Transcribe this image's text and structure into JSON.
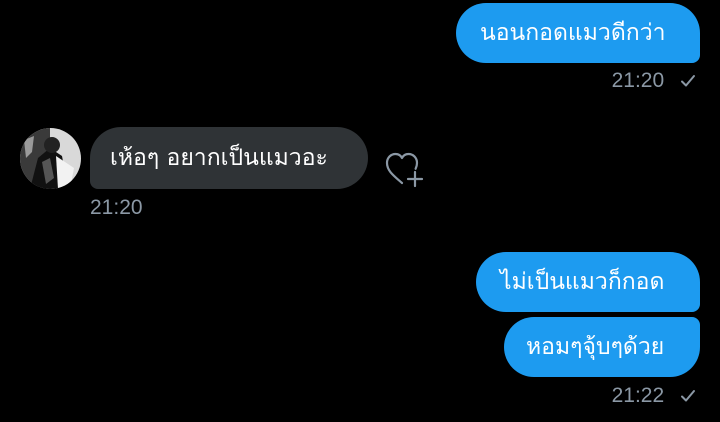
{
  "colors": {
    "background": "#000000",
    "outgoing_bubble": "#1d9bf0",
    "incoming_bubble": "#2f3336",
    "timestamp": "#8b98a5"
  },
  "messages": [
    {
      "direction": "outgoing",
      "text": "นอนกอดแมวดีกว่า"
    },
    {
      "direction": "incoming",
      "text": "เห้อๆ อยากเป็นแมวอะ"
    },
    {
      "direction": "outgoing",
      "text": "ไม่เป็นแมวก็กอด"
    },
    {
      "direction": "outgoing",
      "text": "หอมๆจุ้บๆด้วย"
    }
  ],
  "timestamps": [
    {
      "time": "21:20",
      "status_icon": "read-check-icon"
    },
    {
      "time": "21:20"
    },
    {
      "time": "21:22",
      "status_icon": "read-check-icon"
    }
  ],
  "icons": {
    "avatar": "user-avatar",
    "react": "heart-plus-icon",
    "status": "check-icon"
  }
}
